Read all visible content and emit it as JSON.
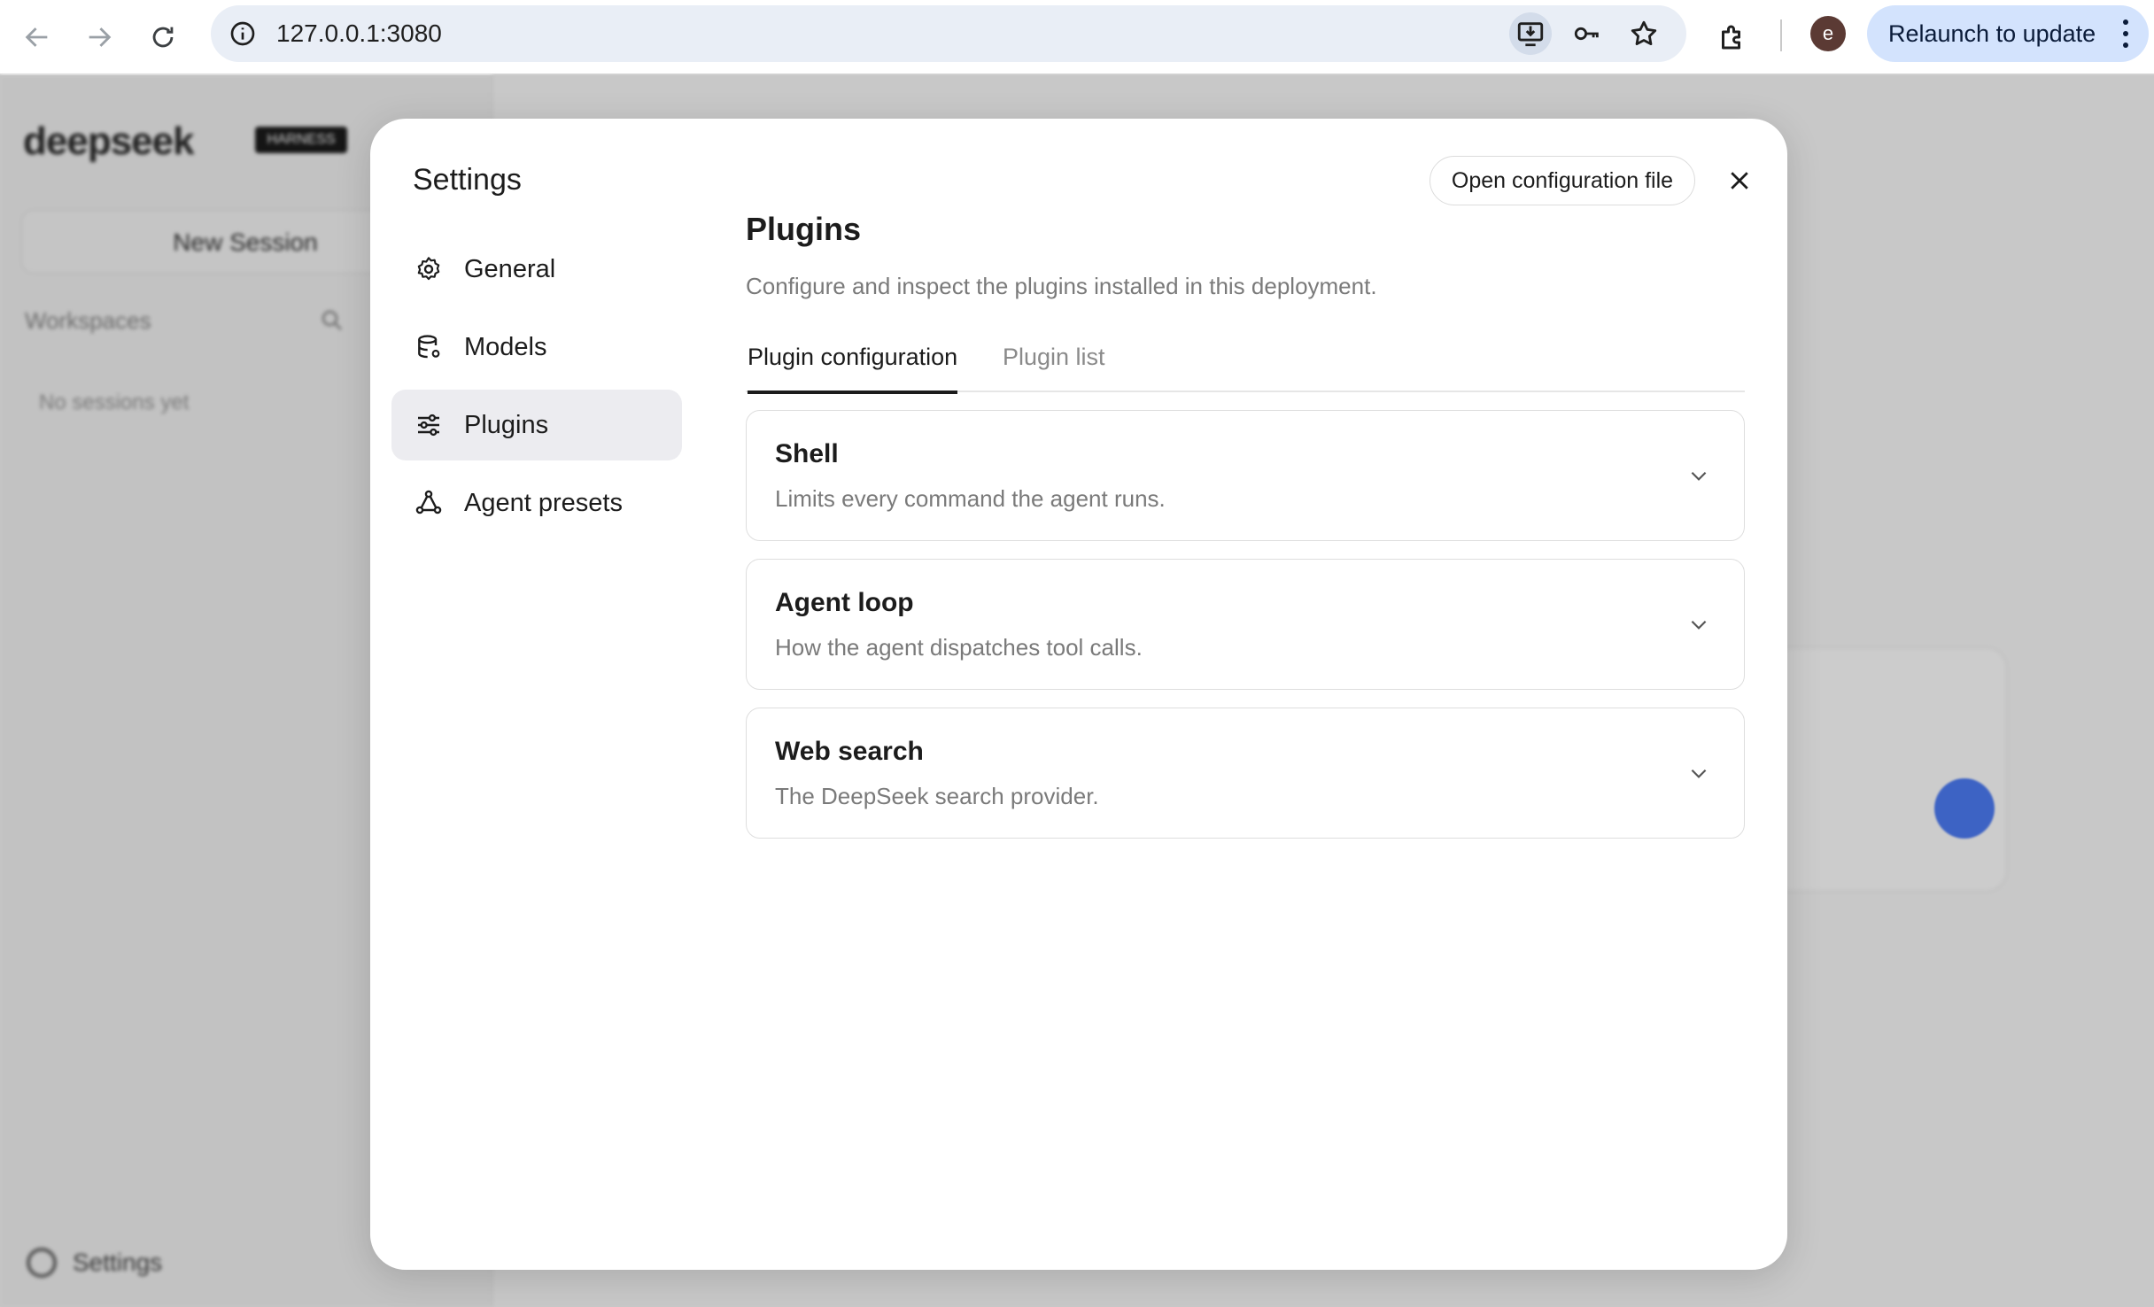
{
  "browser": {
    "url": "127.0.0.1:3080",
    "relaunch_label": "Relaunch to update",
    "profile_initial": "e",
    "icons": [
      "back-icon",
      "forward-icon",
      "reload-icon",
      "site-info-icon",
      "install-app-icon",
      "password-key-icon",
      "bookmark-star-icon",
      "extensions-icon",
      "more-vert-icon"
    ]
  },
  "background_app": {
    "logo_text": "deepseek",
    "logo_badge": "HARNESS",
    "new_session_label": "New Session",
    "workspaces_label": "Workspaces",
    "no_sessions_label": "No sessions yet",
    "settings_label": "Settings"
  },
  "modal": {
    "title": "Settings",
    "open_config_label": "Open configuration file",
    "nav": [
      {
        "label": "General",
        "icon": "gear-icon"
      },
      {
        "label": "Models",
        "icon": "database-icon"
      },
      {
        "label": "Plugins",
        "icon": "sliders-icon",
        "active": true
      },
      {
        "label": "Agent presets",
        "icon": "agent-network-icon"
      }
    ],
    "content": {
      "title": "Plugins",
      "subtitle": "Configure and inspect the plugins installed in this deployment.",
      "tabs": [
        {
          "label": "Plugin configuration",
          "active": true
        },
        {
          "label": "Plugin list",
          "active": false
        }
      ],
      "plugins": [
        {
          "title": "Shell",
          "description": "Limits every command the agent runs."
        },
        {
          "title": "Agent loop",
          "description": "How the agent dispatches tool calls."
        },
        {
          "title": "Web search",
          "description": "The DeepSeek search provider."
        }
      ]
    }
  },
  "colors": {
    "accent_relaunch": "#d3e3fd",
    "active_nav_bg": "#ececf0",
    "send_button": "#4d7cf6"
  }
}
